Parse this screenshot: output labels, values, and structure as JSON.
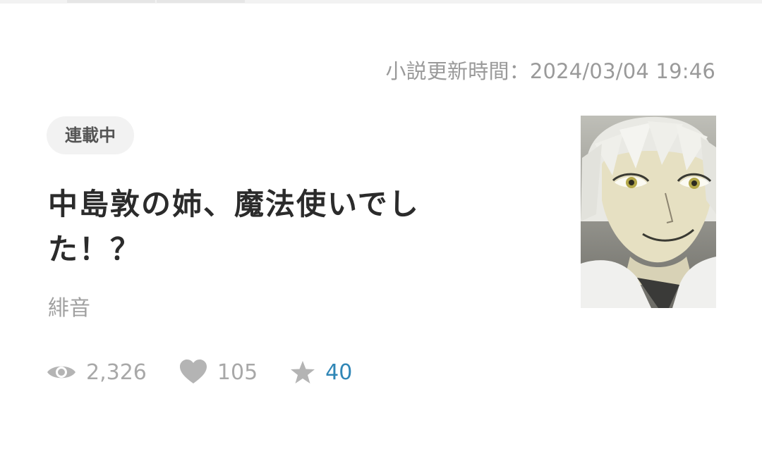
{
  "update": {
    "text": "小説更新時間：2024/03/04 19:46"
  },
  "novel": {
    "status": "連載中",
    "title": "中島敦の姉、魔法使いでした！？",
    "author": "緋音"
  },
  "stats": {
    "views": "2,326",
    "likes": "105",
    "stars": "40"
  },
  "icons": {
    "views": "eye-icon",
    "likes": "heart-icon",
    "stars": "star-icon"
  },
  "colors": {
    "accent": "#2f86b6",
    "muted": "#a8a8a8",
    "title": "#2b2b2b"
  }
}
